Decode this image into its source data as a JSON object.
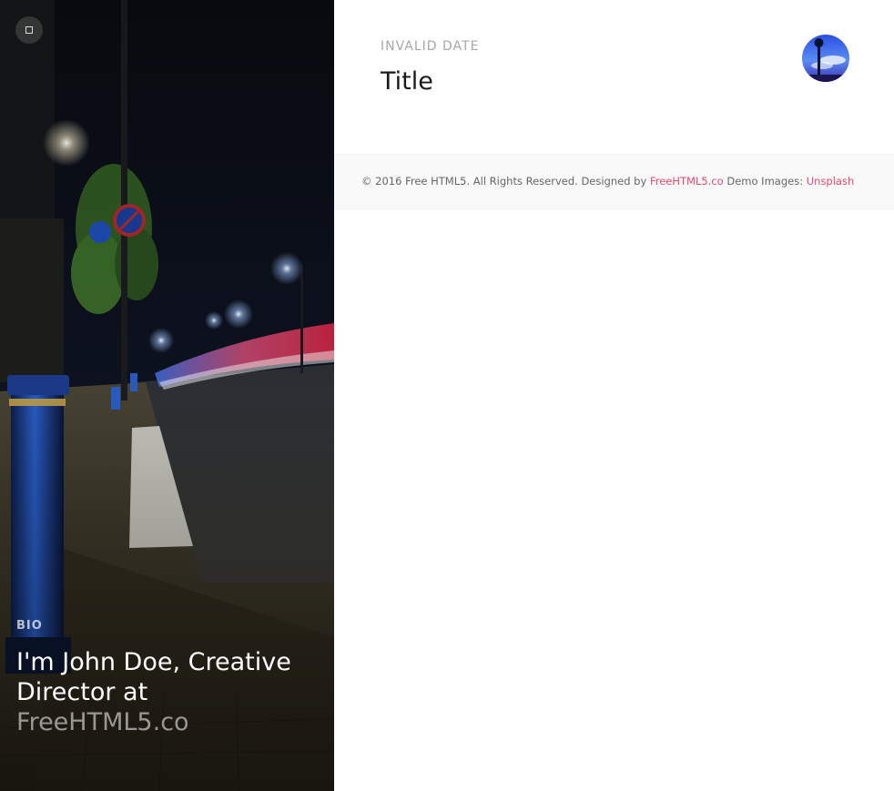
{
  "hero": {
    "menu_icon": "square-menu-icon",
    "bio_label": "BIO",
    "bio_text": "I'm John Doe, Creative Director at ",
    "bio_link": "FreeHTML5.co"
  },
  "post": {
    "date": "INVALID DATE",
    "title": "Title",
    "thumb_icon": "post-thumbnail"
  },
  "footer": {
    "copyright": "© 2016 Free HTML5. All Rights Reserved. Designed by ",
    "designer_link": "FreeHTML5.co",
    "demo_images_label": " Demo Images: ",
    "images_link": "Unsplash"
  },
  "colors": {
    "accent": "#e8476e",
    "date": "#a8a8a8",
    "footer_bg": "#f9f9f9"
  }
}
